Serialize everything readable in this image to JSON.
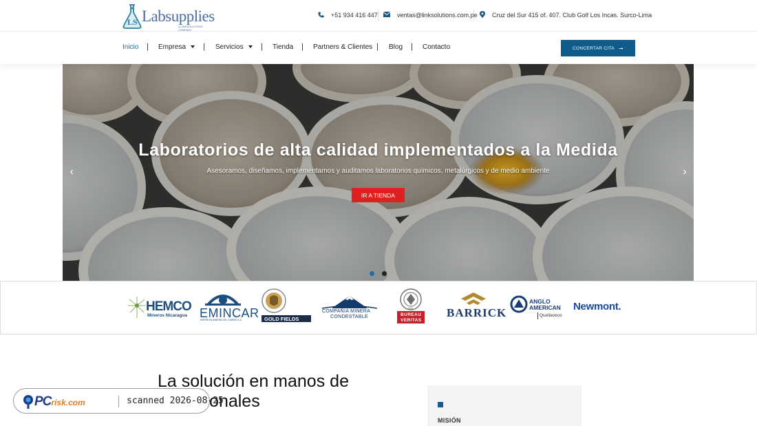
{
  "header": {
    "logo": {
      "name": "Labsupplies",
      "sub": "A LINKSOLUTIONS COMPANY"
    },
    "phone": "+51 934 416 447",
    "email": "ventas@linksolutions.com.pe",
    "address": "Cruz del Sur 415 of. 407. Club Golf Los Incas. Surco-Lima"
  },
  "nav": {
    "items": [
      {
        "label": "Inicio",
        "active": true
      },
      {
        "label": "Empresa",
        "dropdown": true
      },
      {
        "label": "Servicios",
        "dropdown": true
      },
      {
        "label": "Tienda"
      },
      {
        "label": "Partners & Clientes"
      },
      {
        "label": "Blog"
      },
      {
        "label": "Contacto"
      }
    ],
    "separator": "|",
    "cta_label": "CONCERTAR CITA",
    "cta_arrow": "➞"
  },
  "hero": {
    "title": "Laboratorios de alta calidad implementados a la Medida",
    "subtitle": "Asesoramos, diseñamos, implementamos y auditamos laboratorios químicos, metalúrgicos y de medio ambiente",
    "button_label": "IR A TIENDA",
    "prev_arrow": "‹",
    "next_arrow": "›",
    "slides_total": 2,
    "active_slide": 1
  },
  "partners": {
    "hemco": {
      "name": "HEMCO",
      "sub": "Mineros Nicaragua"
    },
    "emincar": {
      "name": "EMINCAR",
      "sub": "EMPRESA MINERA DEL CARIBE S.A."
    },
    "goldfields": {
      "name": "GOLD FIELDS"
    },
    "condestable": {
      "line1": "COMPAÑIA MINERA",
      "line2": "CONDESTABLE"
    },
    "bureau": {
      "line1": "BUREAU",
      "line2": "VERITAS",
      "year": "1828"
    },
    "barrick": {
      "name": "BARRICK"
    },
    "anglo": {
      "line1": "ANGLO",
      "line2": "AMERICAN",
      "sub": "Quellaveco"
    },
    "newmont": {
      "name": "Newmont."
    }
  },
  "about": {
    "headline": "La solución en manos de profesionales",
    "card_label": "MISIÓN"
  },
  "watermark": {
    "brand": "PC",
    "brand_suffix": "risk.com",
    "scanned": "scanned 2026-08-25"
  },
  "colors": {
    "primary": "#0e5c8b",
    "nav_active": "#1b6ea7",
    "hero_button": "#e02020",
    "dot_active": "#1b6ea7",
    "dot_inactive": "#222222",
    "newmont": "#1a4b9c",
    "barrick": "#1f3a6e",
    "barrick_gold": "#b48a2d"
  }
}
